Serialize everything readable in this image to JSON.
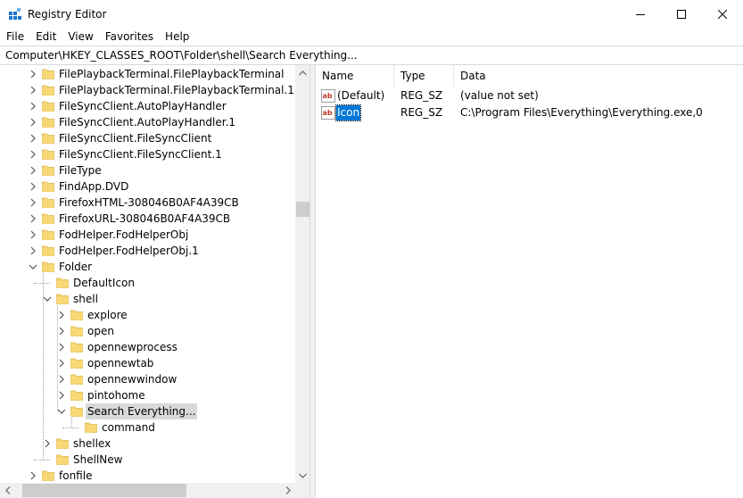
{
  "window": {
    "title": "Registry Editor",
    "controls": {
      "minimize": "minimize",
      "maximize": "maximize",
      "close": "close"
    }
  },
  "menu": [
    {
      "label": "File",
      "name": "menu-file"
    },
    {
      "label": "Edit",
      "name": "menu-edit"
    },
    {
      "label": "View",
      "name": "menu-view"
    },
    {
      "label": "Favorites",
      "name": "menu-favorites"
    },
    {
      "label": "Help",
      "name": "menu-help"
    }
  ],
  "address": {
    "value": "Computer\\HKEY_CLASSES_ROOT\\Folder\\shell\\Search Everything..."
  },
  "tree": {
    "items": [
      {
        "label": "FilePlaybackTerminal.FilePlaybackTerminal",
        "level": 0,
        "expander": "collapsed",
        "selected": false
      },
      {
        "label": "FilePlaybackTerminal.FilePlaybackTerminal.1",
        "level": 0,
        "expander": "collapsed",
        "selected": false
      },
      {
        "label": "FileSyncClient.AutoPlayHandler",
        "level": 0,
        "expander": "collapsed",
        "selected": false
      },
      {
        "label": "FileSyncClient.AutoPlayHandler.1",
        "level": 0,
        "expander": "collapsed",
        "selected": false
      },
      {
        "label": "FileSyncClient.FileSyncClient",
        "level": 0,
        "expander": "collapsed",
        "selected": false
      },
      {
        "label": "FileSyncClient.FileSyncClient.1",
        "level": 0,
        "expander": "collapsed",
        "selected": false
      },
      {
        "label": "FileType",
        "level": 0,
        "expander": "collapsed",
        "selected": false
      },
      {
        "label": "FindApp.DVD",
        "level": 0,
        "expander": "collapsed",
        "selected": false
      },
      {
        "label": "FirefoxHTML-308046B0AF4A39CB",
        "level": 0,
        "expander": "collapsed",
        "selected": false
      },
      {
        "label": "FirefoxURL-308046B0AF4A39CB",
        "level": 0,
        "expander": "collapsed",
        "selected": false
      },
      {
        "label": "FodHelper.FodHelperObj",
        "level": 0,
        "expander": "collapsed",
        "selected": false
      },
      {
        "label": "FodHelper.FodHelperObj.1",
        "level": 0,
        "expander": "collapsed",
        "selected": false
      },
      {
        "label": "Folder",
        "level": 0,
        "expander": "expanded",
        "selected": false
      },
      {
        "label": "DefaultIcon",
        "level": 1,
        "expander": "none",
        "selected": false
      },
      {
        "label": "shell",
        "level": 1,
        "expander": "expanded",
        "selected": false
      },
      {
        "label": "explore",
        "level": 2,
        "expander": "collapsed",
        "selected": false
      },
      {
        "label": "open",
        "level": 2,
        "expander": "collapsed",
        "selected": false
      },
      {
        "label": "opennewprocess",
        "level": 2,
        "expander": "collapsed",
        "selected": false
      },
      {
        "label": "opennewtab",
        "level": 2,
        "expander": "collapsed",
        "selected": false
      },
      {
        "label": "opennewwindow",
        "level": 2,
        "expander": "collapsed",
        "selected": false
      },
      {
        "label": "pintohome",
        "level": 2,
        "expander": "collapsed",
        "selected": false
      },
      {
        "label": "Search Everything...",
        "level": 2,
        "expander": "expanded",
        "selected": true
      },
      {
        "label": "command",
        "level": 3,
        "expander": "none",
        "selected": false
      },
      {
        "label": "shellex",
        "level": 1,
        "expander": "collapsed",
        "selected": false
      },
      {
        "label": "ShellNew",
        "level": 1,
        "expander": "none",
        "selected": false
      },
      {
        "label": "fonfile",
        "level": 0,
        "expander": "collapsed",
        "selected": false
      }
    ]
  },
  "values": {
    "columns": {
      "name": "Name",
      "type": "Type",
      "data": "Data"
    },
    "rows": [
      {
        "name": "(Default)",
        "type": "REG_SZ",
        "data": "(value not set)",
        "icon": "reg-string-icon",
        "selected": false
      },
      {
        "name": "Icon",
        "type": "REG_SZ",
        "data": "C:\\Program Files\\Everything\\Everything.exe,0",
        "icon": "reg-string-icon",
        "selected": true
      }
    ]
  },
  "colors": {
    "selection_focus": "#0078d7",
    "selection_inactive": "#d9d9d9",
    "folder": "#f8d775",
    "scrollbar_track": "#f0f0f0",
    "scrollbar_thumb": "#cdcdcd"
  }
}
